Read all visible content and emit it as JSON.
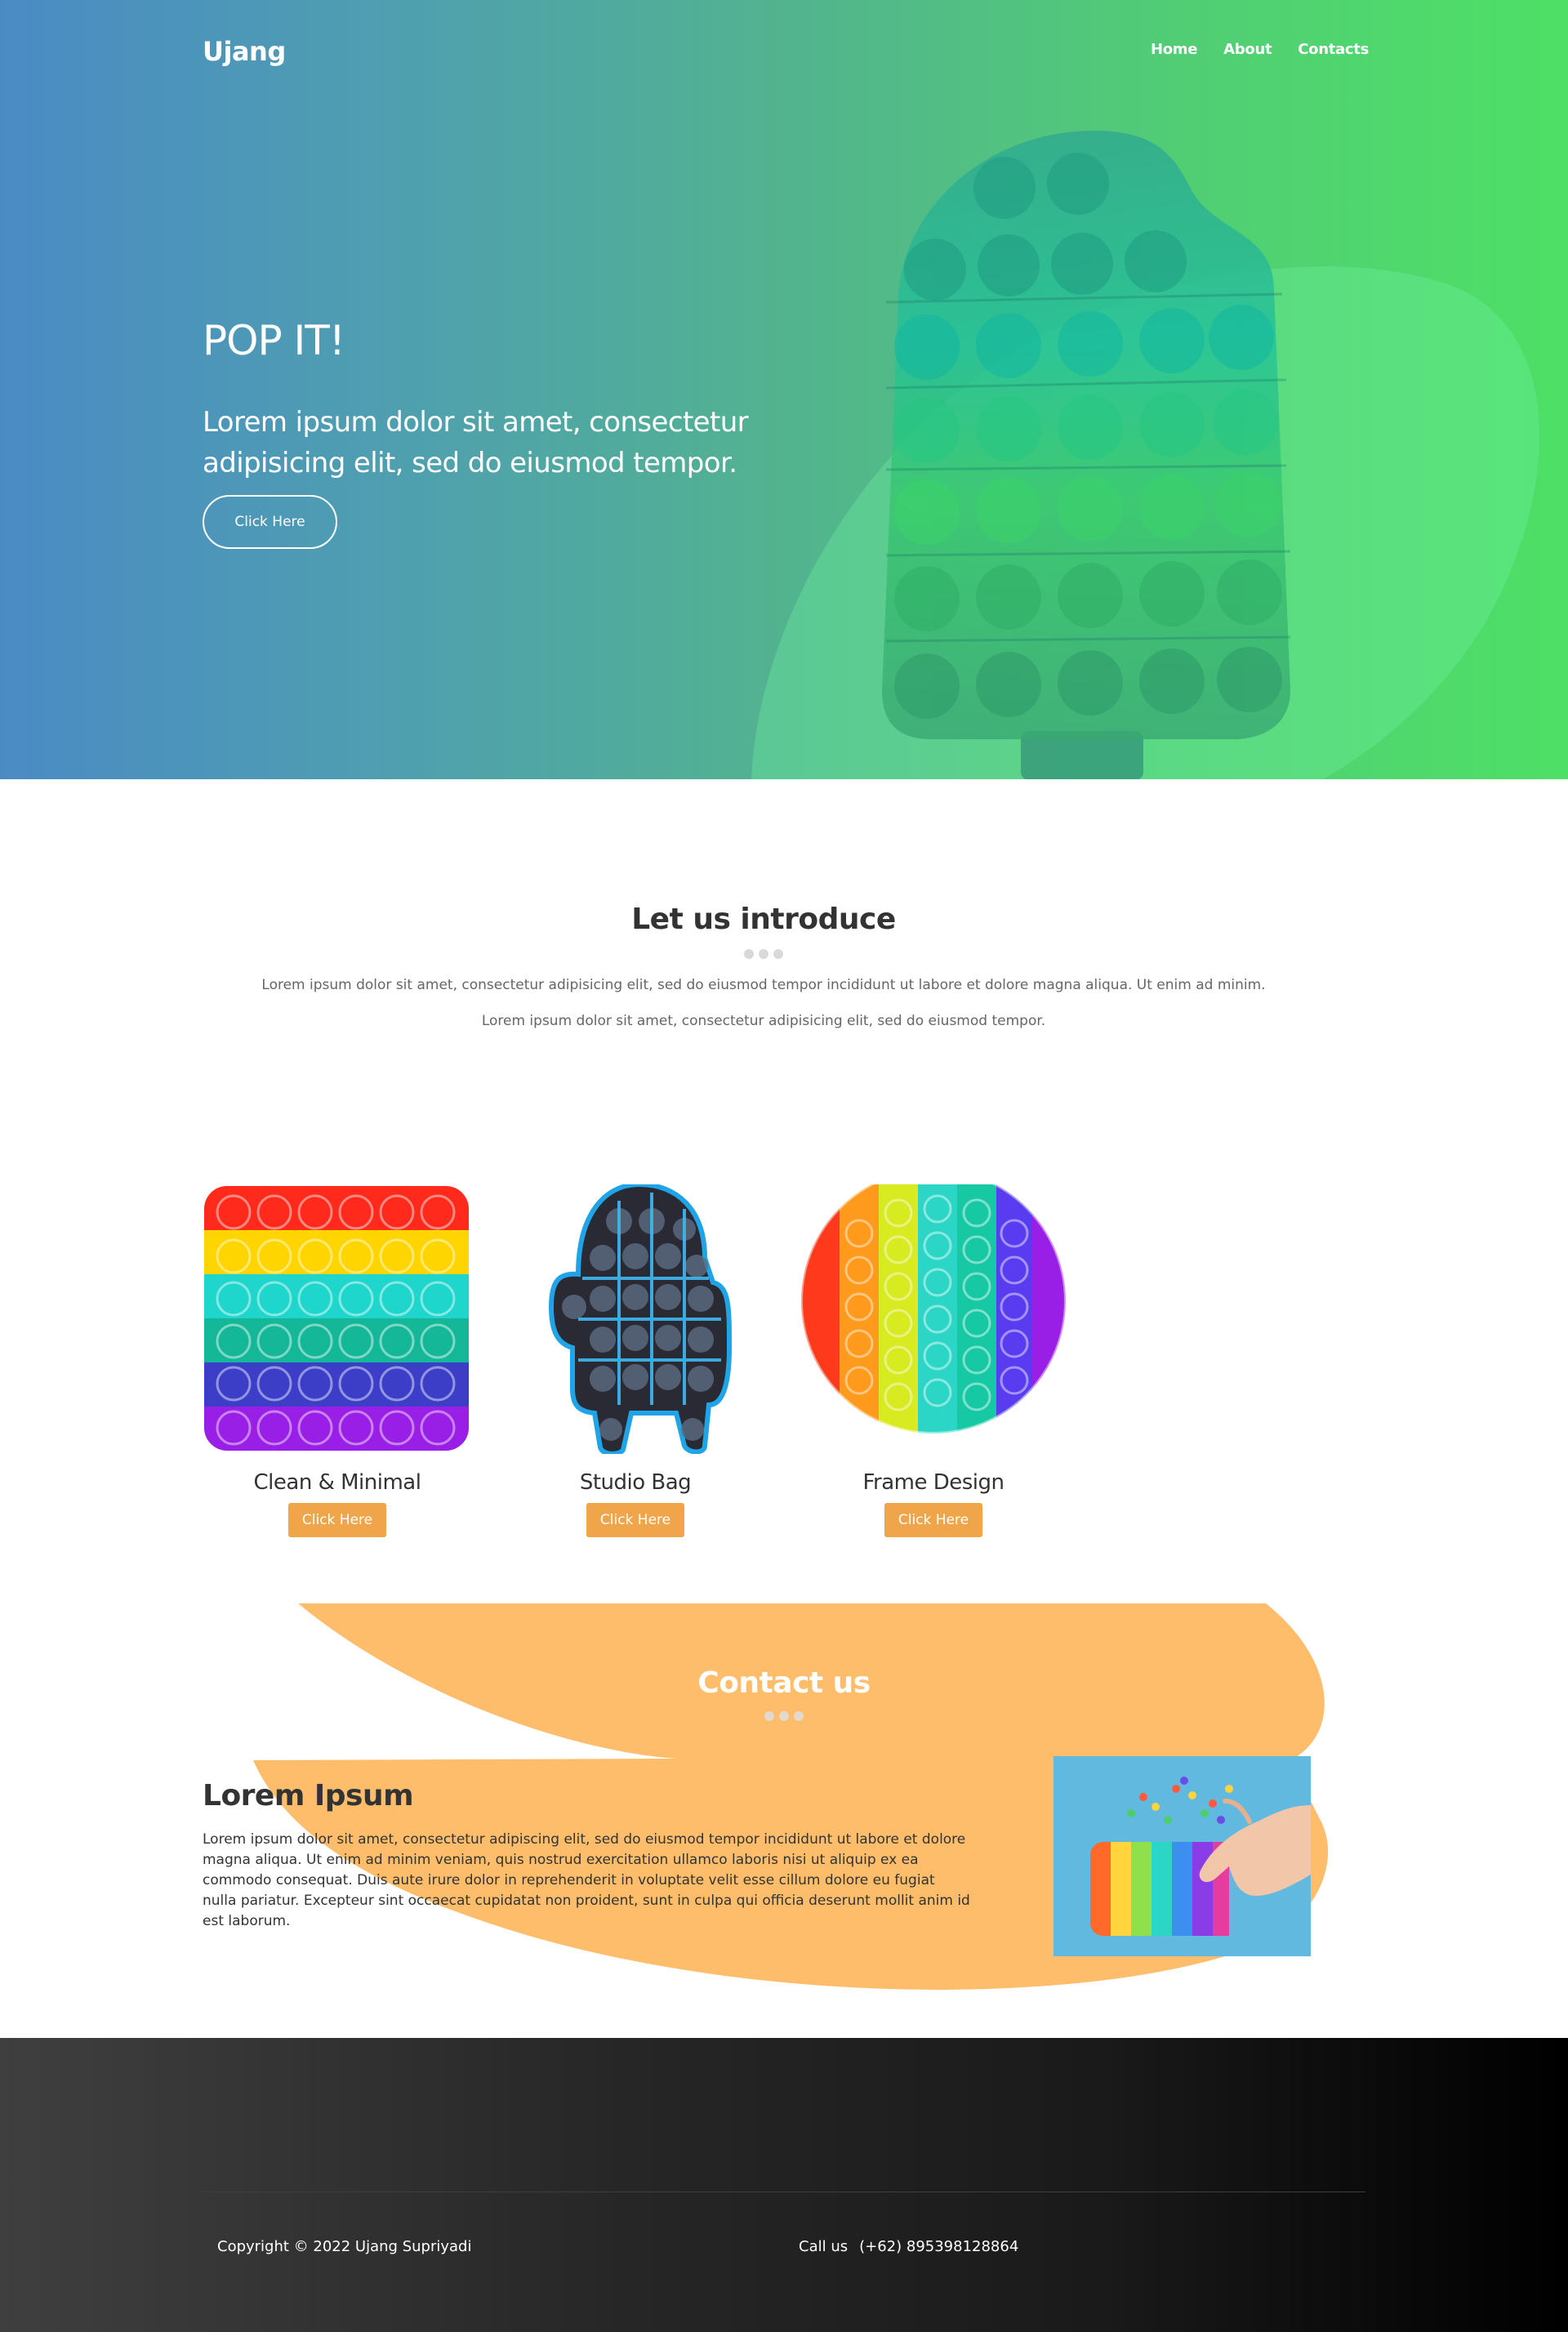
{
  "nav": {
    "logo": "Ujang",
    "items": [
      {
        "label": "Home"
      },
      {
        "label": "About"
      },
      {
        "label": "Contacts"
      }
    ]
  },
  "hero": {
    "title": "POP IT!",
    "subtitle": "Lorem ipsum dolor sit amet, consectetur adipisicing elit, sed do eiusmod tempor.",
    "button": "Click Here"
  },
  "intro": {
    "title": "Let us introduce",
    "paragraph1": "Lorem ipsum dolor sit amet, consectetur adipisicing elit, sed do eiusmod tempor incididunt ut labore et dolore magna aliqua. Ut enim ad minim.",
    "paragraph2": "Lorem ipsum dolor sit amet, consectetur adipisicing elit, sed do eiusmod tempor."
  },
  "products": [
    {
      "name": "Clean & Minimal",
      "button": "Click Here"
    },
    {
      "name": "Studio Bag",
      "button": "Click Here"
    },
    {
      "name": "Frame Design",
      "button": "Click Here"
    }
  ],
  "contact": {
    "title": "Contact us",
    "heading": "Lorem Ipsum",
    "body": "Lorem ipsum dolor sit amet, consectetur adipiscing elit, sed do eiusmod tempor incididunt ut labore et dolore magna aliqua. Ut enim ad minim veniam, quis nostrud exercitation ullamco laboris nisi ut aliquip ex ea commodo consequat. Duis aute irure dolor in reprehenderit in voluptate velit esse cillum dolore eu fugiat nulla pariatur. Excepteur sint occaecat cupidatat non proident, sunt in culpa qui officia deserunt mollit anim id est laborum."
  },
  "footer": {
    "copyright": "Copyright © 2022 Ujang Supriyadi",
    "call_label": "Call us",
    "phone": "(+62) 895398128864"
  },
  "colors": {
    "hero_gradient_start": "#4a8bc4",
    "hero_gradient_end": "#4ee066",
    "accent_orange": "#f0a54a",
    "contact_blob": "#fdbd6a",
    "footer_dark": "#000000"
  }
}
